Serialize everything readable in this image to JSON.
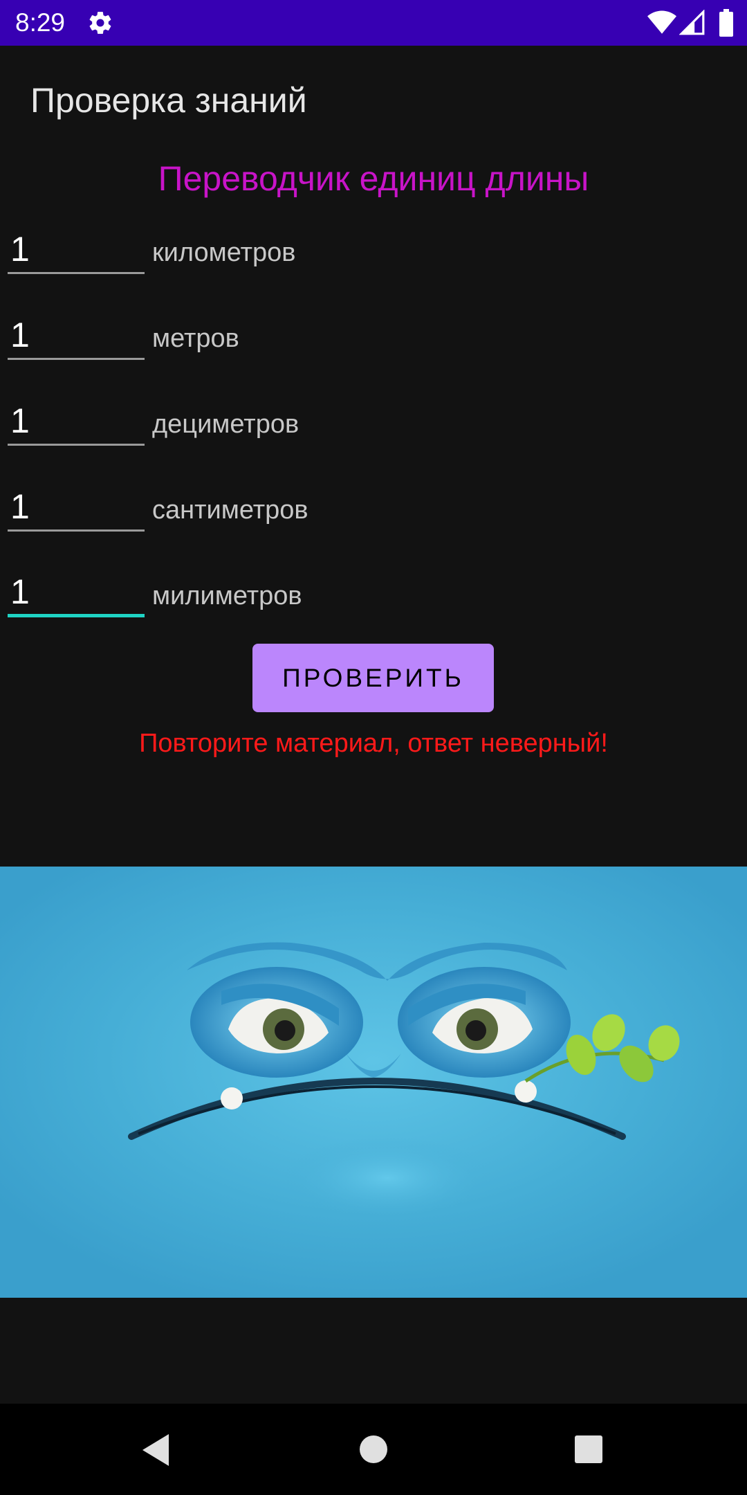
{
  "status_bar": {
    "time": "8:29",
    "icons": [
      "gear-icon",
      "wifi-icon",
      "signal-icon",
      "battery-icon"
    ]
  },
  "toolbar": {
    "title": "Проверка знаний"
  },
  "screen": {
    "heading": "Переводчик единиц длины"
  },
  "units": [
    {
      "value": "1",
      "label": "километров"
    },
    {
      "value": "1",
      "label": "метров"
    },
    {
      "value": "1",
      "label": "дециметров"
    },
    {
      "value": "1",
      "label": "сантиметров"
    },
    {
      "value": "1",
      "label": "милиметров"
    }
  ],
  "check_button": {
    "label": "ПРОВЕРИТЬ"
  },
  "result": {
    "message": "Повторите материал, ответ неверный!"
  },
  "image": {
    "subject": "angry-blue-face-icon"
  },
  "navigation": {
    "icons": [
      "back-icon",
      "home-icon",
      "recents-icon"
    ]
  },
  "colors": {
    "status_bar": "#3700b3",
    "background": "#121212",
    "heading": "#c814c8",
    "button": "#bb86fc",
    "error": "#ff1a1a",
    "active_underline": "#1fd4c4"
  }
}
